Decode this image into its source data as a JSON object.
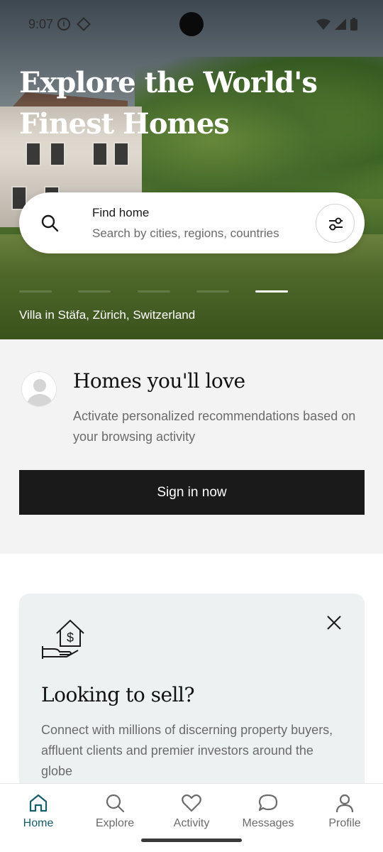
{
  "status_bar": {
    "time": "9:07"
  },
  "hero": {
    "title": "Explore the World's Finest Homes",
    "caption": "Villa in Stäfa, Zürich, Switzerland",
    "carousel_count": 5,
    "carousel_active_index": 4
  },
  "search": {
    "title": "Find home",
    "placeholder": "Search by cities, regions, countries",
    "search_icon": "search-icon",
    "filter_icon": "filter-sliders-icon"
  },
  "recommendations": {
    "title": "Homes you'll love",
    "description": "Activate personalized recommendations based on your browsing activity",
    "button_label": "Sign in now"
  },
  "sell_card": {
    "title": "Looking to sell?",
    "description": "Connect with millions of discerning property buyers, affluent clients and premier investors around the globe",
    "icon": "house-dollar-hand-icon",
    "close_icon": "close-icon"
  },
  "bottom_nav": {
    "items": [
      {
        "label": "Home",
        "icon": "home-icon",
        "active": true
      },
      {
        "label": "Explore",
        "icon": "search-icon",
        "active": false
      },
      {
        "label": "Activity",
        "icon": "heart-icon",
        "active": false
      },
      {
        "label": "Messages",
        "icon": "chat-bubble-icon",
        "active": false
      },
      {
        "label": "Profile",
        "icon": "person-icon",
        "active": false
      }
    ]
  },
  "colors": {
    "accent": "#13606b",
    "button_dark": "#1a1a1a",
    "section_bg": "#f3f3f3",
    "card_bg": "#edf1f1"
  }
}
